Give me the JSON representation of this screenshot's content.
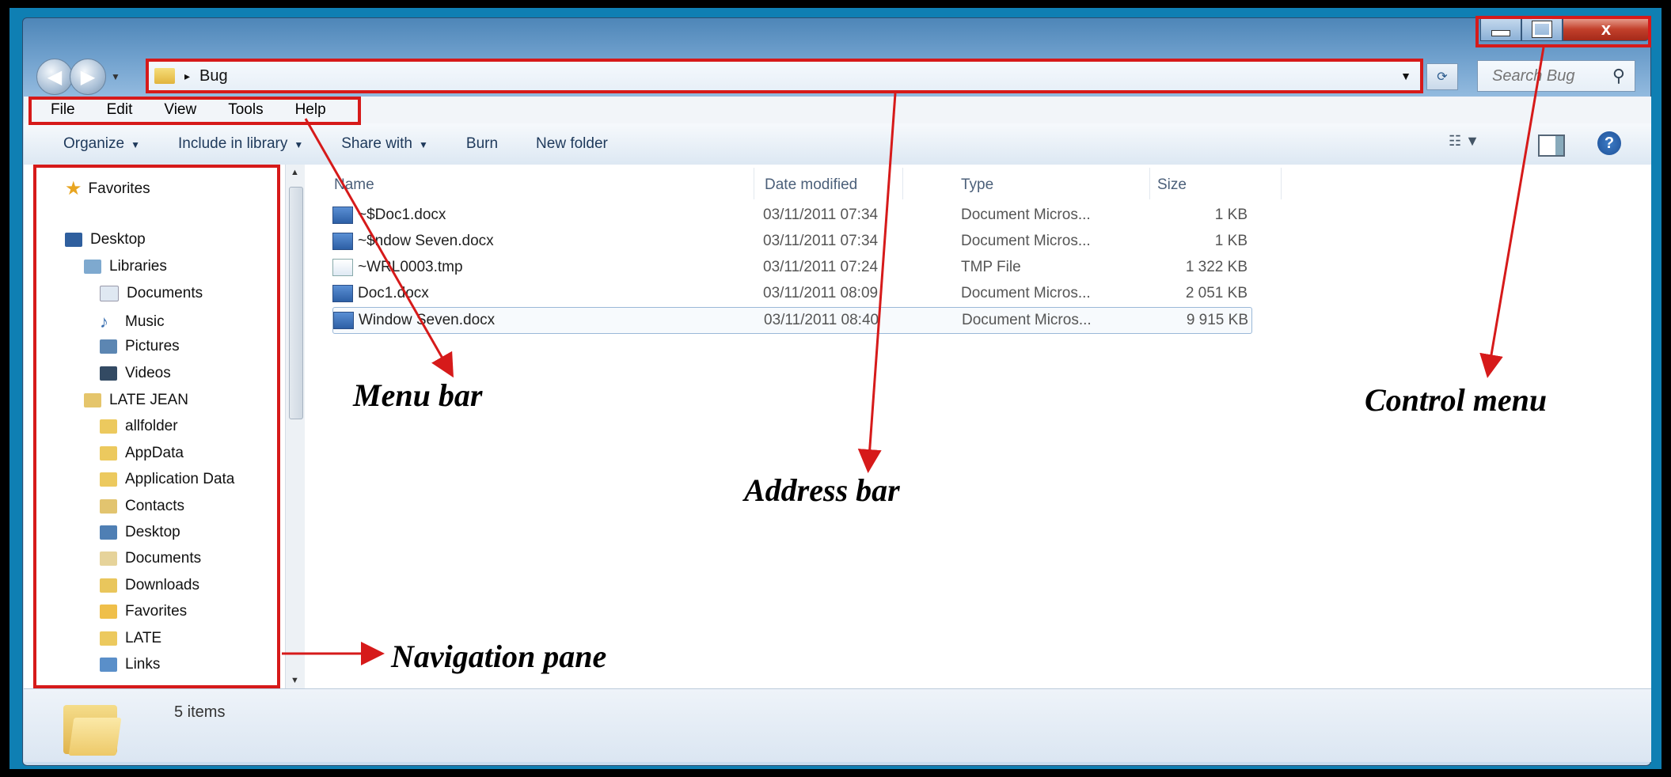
{
  "window": {
    "controls": {
      "minimize_icon": "minimize-icon",
      "maximize_icon": "maximize-icon",
      "close_icon": "close-icon",
      "close_glyph": "x"
    }
  },
  "address_bar": {
    "path": "Bug",
    "separator": "▸"
  },
  "search": {
    "placeholder": "Search Bug"
  },
  "menu_bar": {
    "items": [
      "File",
      "Edit",
      "View",
      "Tools",
      "Help"
    ]
  },
  "toolbar": {
    "organize": "Organize",
    "include_in_library": "Include in library",
    "share_with": "Share with",
    "burn": "Burn",
    "new_folder": "New folder"
  },
  "navigation_pane": {
    "favorites": "Favorites",
    "desktop": "Desktop",
    "libraries": "Libraries",
    "documents": "Documents",
    "music": "Music",
    "pictures": "Pictures",
    "videos": "Videos",
    "user": "LATE JEAN",
    "allfolder": "allfolder",
    "appdata": "AppData",
    "application_data": "Application Data",
    "contacts": "Contacts",
    "desktop2": "Desktop",
    "documents2": "Documents",
    "downloads": "Downloads",
    "favorites2": "Favorites",
    "late": "LATE",
    "links": "Links"
  },
  "file_list": {
    "columns": {
      "name": "Name",
      "date": "Date modified",
      "type": "Type",
      "size": "Size"
    },
    "rows": [
      {
        "name": "~$Doc1.docx",
        "date": "03/11/2011 07:34",
        "type": "Document Micros...",
        "size": "1 KB"
      },
      {
        "name": "~$ndow Seven.docx",
        "date": "03/11/2011 07:34",
        "type": "Document Micros...",
        "size": "1 KB"
      },
      {
        "name": "~WRL0003.tmp",
        "date": "03/11/2011 07:24",
        "type": "TMP File",
        "size": "1 322 KB"
      },
      {
        "name": "Doc1.docx",
        "date": "03/11/2011 08:09",
        "type": "Document Micros...",
        "size": "2 051 KB"
      },
      {
        "name": "Window Seven.docx",
        "date": "03/11/2011 08:40",
        "type": "Document Micros...",
        "size": "9 915 KB"
      }
    ]
  },
  "status_bar": {
    "items_count": "5 items"
  },
  "annotations": {
    "menu_bar": "Menu bar",
    "address_bar": "Address bar",
    "control_menu": "Control menu",
    "navigation_pane": "Navigation pane"
  },
  "colors": {
    "highlight": "#d61a1a",
    "frame": "#0f7fb3",
    "background": "#000000"
  }
}
